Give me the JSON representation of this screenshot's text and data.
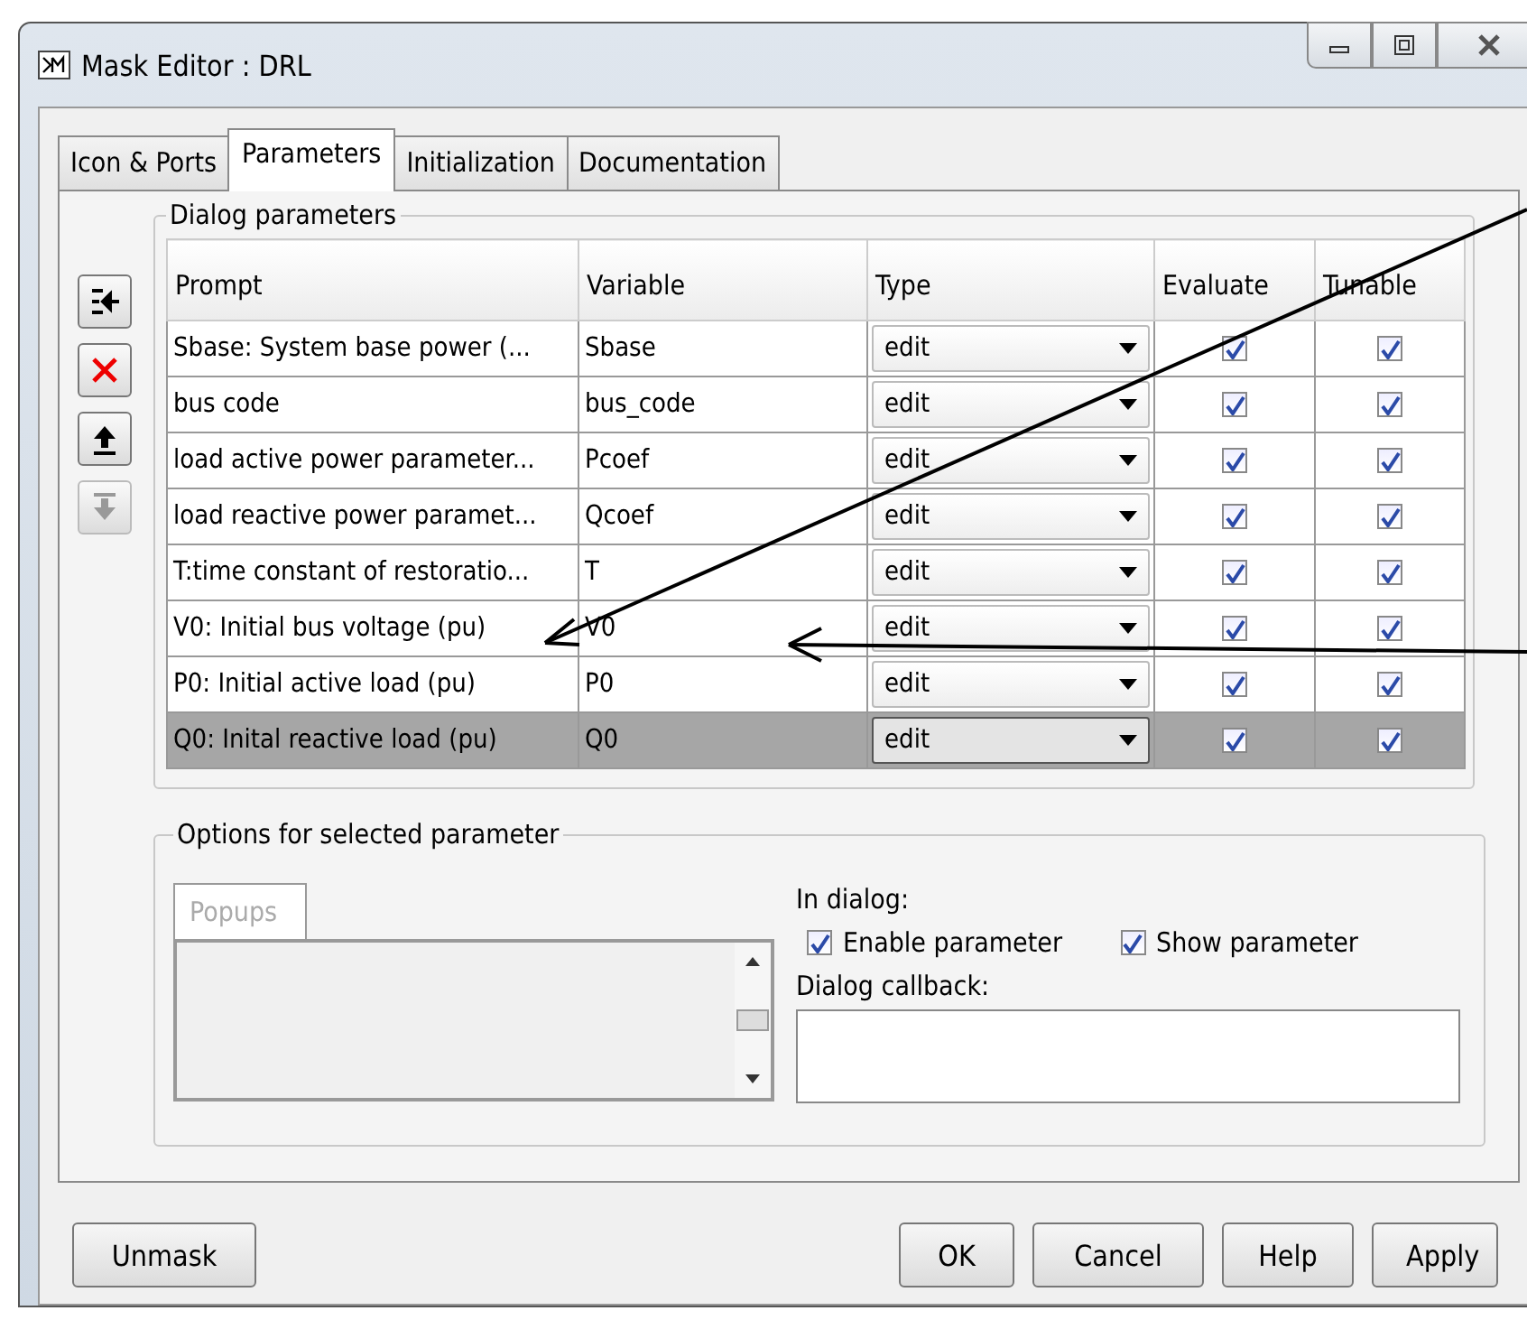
{
  "window": {
    "title": "Mask Editor : DRL"
  },
  "tabs": [
    {
      "label": "Icon & Ports",
      "selected": false
    },
    {
      "label": "Parameters",
      "selected": true
    },
    {
      "label": "Initialization",
      "selected": false
    },
    {
      "label": "Documentation",
      "selected": false
    }
  ],
  "side_tools": [
    {
      "kind": "insert",
      "disabled": false
    },
    {
      "kind": "delete",
      "disabled": false
    },
    {
      "kind": "up",
      "disabled": false
    },
    {
      "kind": "down",
      "disabled": true
    }
  ],
  "dialog_parameters": {
    "title": "Dialog parameters",
    "columns": [
      "Prompt",
      "Variable",
      "Type",
      "Evaluate",
      "Tunable"
    ],
    "rows": [
      {
        "prompt": "Sbase: System base power (...",
        "variable": "Sbase",
        "type": "edit",
        "evaluate": true,
        "tunable": true,
        "selected": false
      },
      {
        "prompt": "bus code",
        "variable": "bus_code",
        "type": "edit",
        "evaluate": true,
        "tunable": true,
        "selected": false
      },
      {
        "prompt": "load active power parameter...",
        "variable": "Pcoef",
        "type": "edit",
        "evaluate": true,
        "tunable": true,
        "selected": false
      },
      {
        "prompt": "load reactive power paramet...",
        "variable": "Qcoef",
        "type": "edit",
        "evaluate": true,
        "tunable": true,
        "selected": false
      },
      {
        "prompt": "T:time constant of restoratio...",
        "variable": "T",
        "type": "edit",
        "evaluate": true,
        "tunable": true,
        "selected": false
      },
      {
        "prompt": "V0: Initial bus voltage (pu)",
        "variable": "V0",
        "type": "edit",
        "evaluate": true,
        "tunable": true,
        "selected": false
      },
      {
        "prompt": "P0: Initial active  load (pu)",
        "variable": "P0",
        "type": "edit",
        "evaluate": true,
        "tunable": true,
        "selected": false
      },
      {
        "prompt": "Q0: Inital reactive load (pu)",
        "variable": "Q0",
        "type": "edit",
        "evaluate": true,
        "tunable": true,
        "selected": true
      }
    ]
  },
  "options": {
    "title": "Options for selected parameter",
    "popups_tab": "Popups",
    "in_dialog": "In dialog:",
    "checkboxes": [
      {
        "label": "Enable parameter",
        "checked": true
      },
      {
        "label": "Show parameter",
        "checked": true
      }
    ],
    "callback_label": "Dialog callback:"
  },
  "left_buttons": [
    "Unmask"
  ],
  "buttons": [
    "OK",
    "Cancel",
    "Help",
    "Apply"
  ]
}
